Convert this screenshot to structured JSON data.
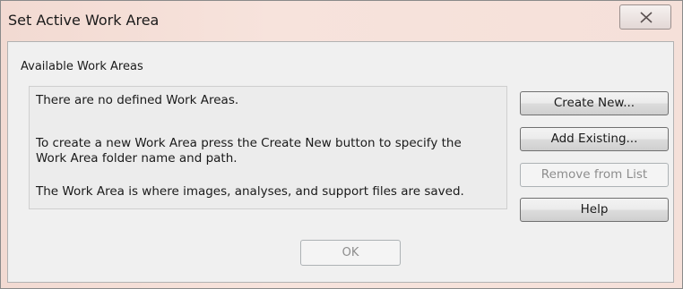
{
  "window": {
    "title": "Set Active Work Area",
    "close_icon": "close-icon"
  },
  "group": {
    "label": "Available Work Areas"
  },
  "messages": [
    "There are no defined Work Areas.",
    "To create a new Work Area press the Create New button to specify the",
    "Work Area folder name and path.",
    "The Work Area is where images, analyses, and support files are saved."
  ],
  "buttons": {
    "create_new": "Create New...",
    "add_existing": "Add Existing...",
    "remove_from_list": "Remove from List",
    "help": "Help",
    "ok": "OK"
  },
  "colors": {
    "title_bar": "#f5e0d9",
    "dialog_background": "#f0f0f0",
    "disabled_text": "#8d8d8d"
  }
}
